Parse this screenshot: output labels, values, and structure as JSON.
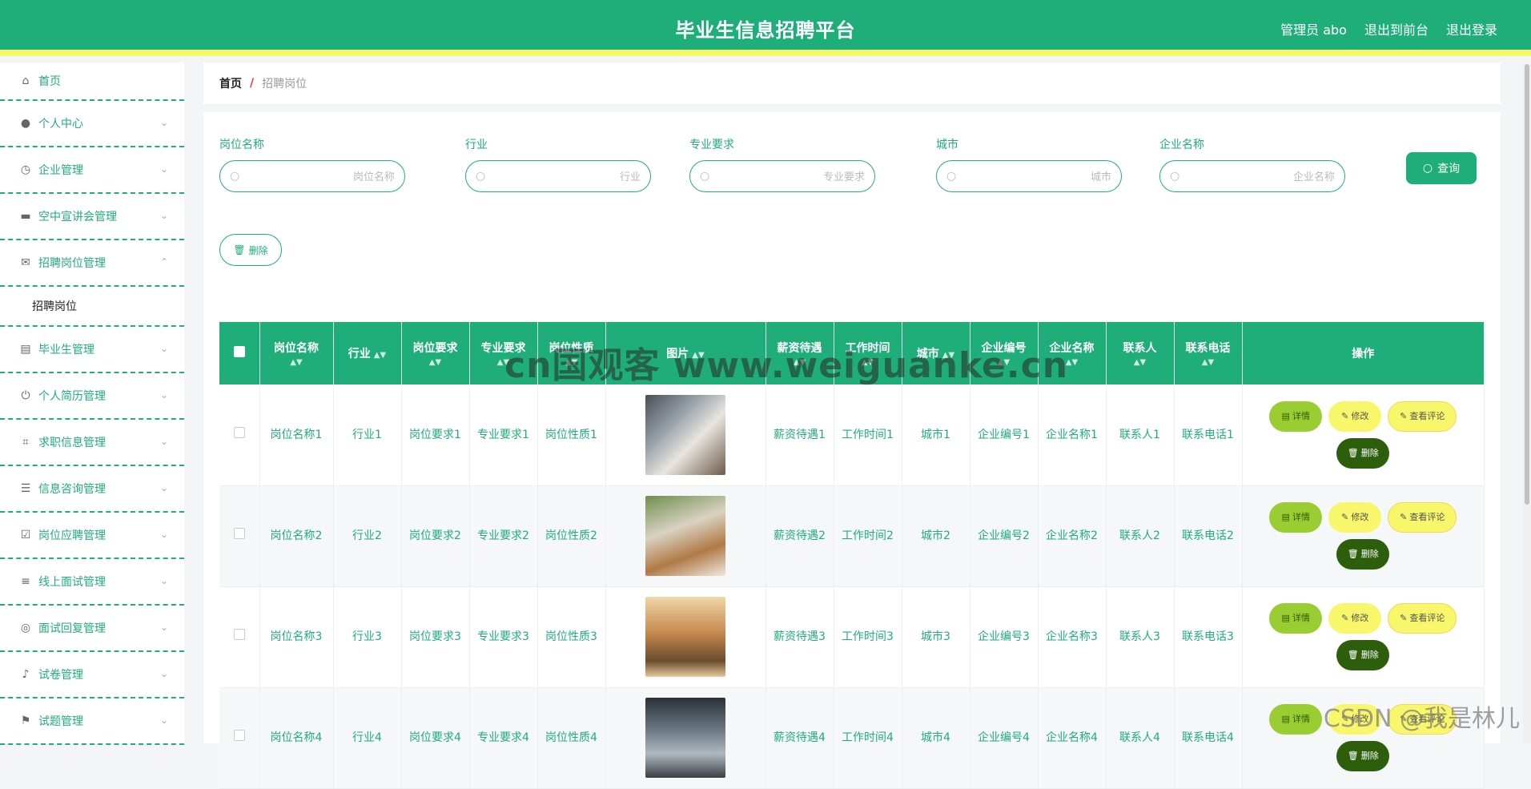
{
  "header": {
    "title": "毕业生信息招聘平台",
    "admin_label": "管理员 abo",
    "to_front": "退出到前台",
    "logout": "退出登录"
  },
  "sidebar": {
    "items": [
      {
        "label": "首页",
        "icon": "home-icon"
      },
      {
        "label": "个人中心",
        "icon": "user-icon"
      },
      {
        "label": "企业管理",
        "icon": "clock-icon"
      },
      {
        "label": "空中宣讲会管理",
        "icon": "briefcase-icon"
      },
      {
        "label": "招聘岗位管理",
        "icon": "mail-icon",
        "expanded": true
      },
      {
        "label": "招聘岗位",
        "sub": true
      },
      {
        "label": "毕业生管理",
        "icon": "clipboard-icon"
      },
      {
        "label": "个人简历管理",
        "icon": "power-icon"
      },
      {
        "label": "求职信息管理",
        "icon": "crop-icon"
      },
      {
        "label": "信息咨询管理",
        "icon": "sliders-icon"
      },
      {
        "label": "岗位应聘管理",
        "icon": "checklist-icon"
      },
      {
        "label": "线上面试管理",
        "icon": "list-icon"
      },
      {
        "label": "面试回复管理",
        "icon": "compass-icon"
      },
      {
        "label": "试卷管理",
        "icon": "mic-icon"
      },
      {
        "label": "试题管理",
        "icon": "flag-icon"
      }
    ]
  },
  "breadcrumb": {
    "home": "首页",
    "sep": "/",
    "current": "招聘岗位"
  },
  "filters": [
    {
      "label": "岗位名称",
      "placeholder": "岗位名称"
    },
    {
      "label": "行业",
      "placeholder": "行业"
    },
    {
      "label": "专业要求",
      "placeholder": "专业要求"
    },
    {
      "label": "城市",
      "placeholder": "城市"
    },
    {
      "label": "企业名称",
      "placeholder": "企业名称"
    }
  ],
  "buttons": {
    "query": "查询",
    "delete": "删除"
  },
  "table": {
    "headers": [
      "岗位名称",
      "行业",
      "岗位要求",
      "专业要求",
      "岗位性质",
      "图片",
      "薪资待遇",
      "工作时间",
      "城市",
      "企业编号",
      "企业名称",
      "联系人",
      "联系电话",
      "操作"
    ],
    "rows": [
      [
        "岗位名称1",
        "行业1",
        "岗位要求1",
        "专业要求1",
        "岗位性质1",
        "薪资待遇1",
        "工作时间1",
        "城市1",
        "企业编号1",
        "企业名称1",
        "联系人1",
        "联系电话1"
      ],
      [
        "岗位名称2",
        "行业2",
        "岗位要求2",
        "专业要求2",
        "岗位性质2",
        "薪资待遇2",
        "工作时间2",
        "城市2",
        "企业编号2",
        "企业名称2",
        "联系人2",
        "联系电话2"
      ],
      [
        "岗位名称3",
        "行业3",
        "岗位要求3",
        "专业要求3",
        "岗位性质3",
        "薪资待遇3",
        "工作时间3",
        "城市3",
        "企业编号3",
        "企业名称3",
        "联系人3",
        "联系电话3"
      ],
      [
        "岗位名称4",
        "行业4",
        "岗位要求4",
        "专业要求4",
        "岗位性质4",
        "薪资待遇4",
        "工作时间4",
        "城市4",
        "企业编号4",
        "企业名称4",
        "联系人4",
        "联系电话4"
      ]
    ],
    "actions": {
      "detail": "详情",
      "edit": "修改",
      "review": "查看评论",
      "remove": "删除"
    }
  },
  "watermarks": {
    "site": "cn国观客 www.weiguanke.cn",
    "csdn": "CSDN @我是林儿"
  },
  "colors": {
    "primary": "#1fad7a",
    "stripe": "#f5f76a",
    "detail": "#9acd32",
    "edit": "#f8f66a",
    "remove": "#2d5e0c"
  }
}
